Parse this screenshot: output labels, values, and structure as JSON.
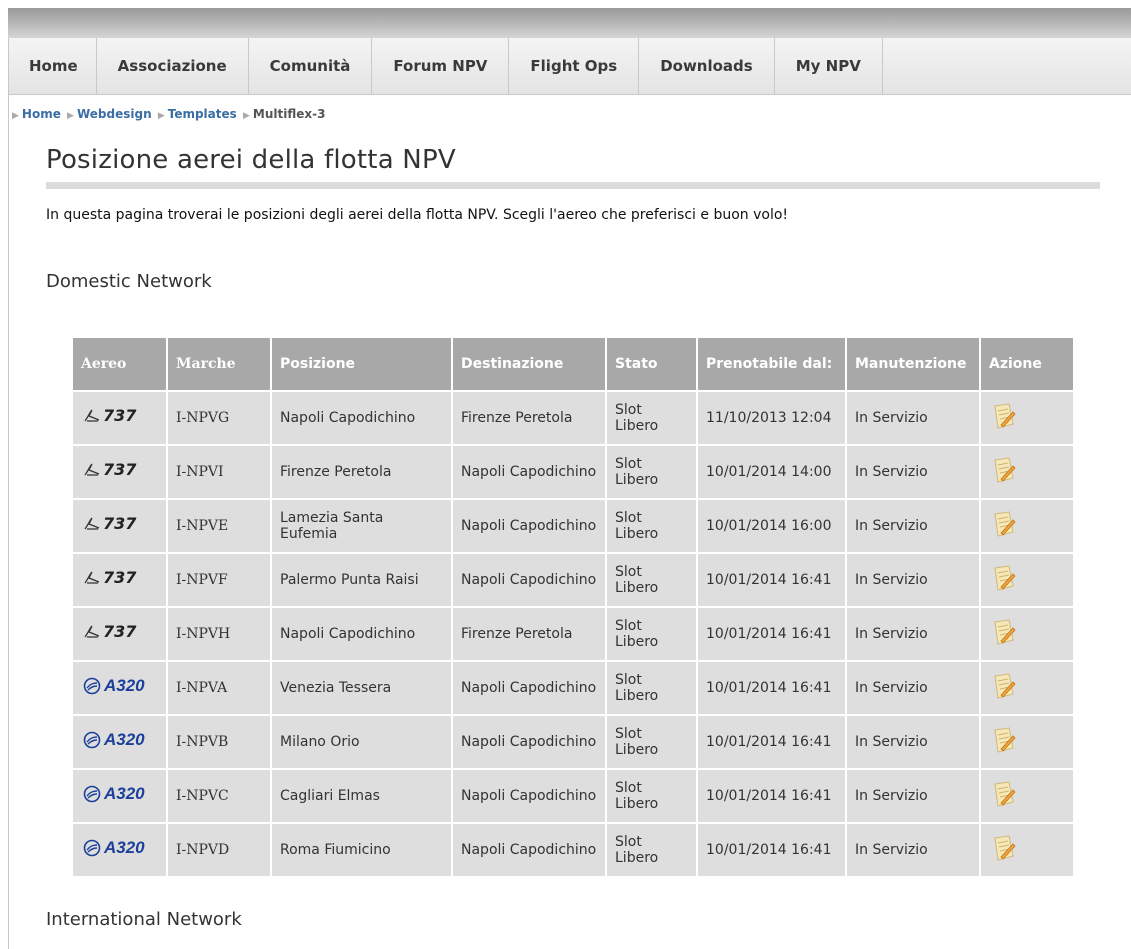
{
  "nav": {
    "items": [
      "Home",
      "Associazione",
      "Comunità",
      "Forum NPV",
      "Flight Ops",
      "Downloads",
      "My NPV"
    ]
  },
  "breadcrumb": {
    "items": [
      "Home",
      "Webdesign",
      "Templates",
      "Multiflex-3"
    ]
  },
  "page": {
    "title": "Posizione aerei della flotta NPV",
    "intro": "In questa pagina troverai le posizioni degli aerei della flotta NPV. Scegli l'aereo che preferisci e buon volo!"
  },
  "sections": {
    "domestic": "Domestic Network",
    "international": "International Network"
  },
  "table": {
    "headers": [
      "Aereo",
      "Marche",
      "Posizione",
      "Destinazione",
      "Stato",
      "Prenotabile dal:",
      "Manutenzione",
      "Azione"
    ],
    "rows": [
      {
        "aircraft": "737",
        "reg": "I-NPVG",
        "position": "Napoli Capodichino",
        "destination": "Firenze Peretola",
        "status": "Slot Libero",
        "available": "11/10/2013 12:04",
        "maintenance": "In Servizio",
        "action_icon": "notepad-icon"
      },
      {
        "aircraft": "737",
        "reg": "I-NPVI",
        "position": "Firenze Peretola",
        "destination": "Napoli Capodichino",
        "status": "Slot Libero",
        "available": "10/01/2014 14:00",
        "maintenance": "In Servizio",
        "action_icon": "notepad-icon"
      },
      {
        "aircraft": "737",
        "reg": "I-NPVE",
        "position": "Lamezia Santa Eufemia",
        "destination": "Napoli Capodichino",
        "status": "Slot Libero",
        "available": "10/01/2014 16:00",
        "maintenance": "In Servizio",
        "action_icon": "notepad-icon"
      },
      {
        "aircraft": "737",
        "reg": "I-NPVF",
        "position": "Palermo Punta Raisi",
        "destination": "Napoli Capodichino",
        "status": "Slot Libero",
        "available": "10/01/2014 16:41",
        "maintenance": "In Servizio",
        "action_icon": "notepad-icon"
      },
      {
        "aircraft": "737",
        "reg": "I-NPVH",
        "position": "Napoli Capodichino",
        "destination": "Firenze Peretola",
        "status": "Slot Libero",
        "available": "10/01/2014 16:41",
        "maintenance": "In Servizio",
        "action_icon": "notepad-icon"
      },
      {
        "aircraft": "A320",
        "reg": "I-NPVA",
        "position": "Venezia Tessera",
        "destination": "Napoli Capodichino",
        "status": "Slot Libero",
        "available": "10/01/2014 16:41",
        "maintenance": "In Servizio",
        "action_icon": "notepad-icon"
      },
      {
        "aircraft": "A320",
        "reg": "I-NPVB",
        "position": "Milano Orio",
        "destination": "Napoli Capodichino",
        "status": "Slot Libero",
        "available": "10/01/2014 16:41",
        "maintenance": "In Servizio",
        "action_icon": "notepad-icon"
      },
      {
        "aircraft": "A320",
        "reg": "I-NPVC",
        "position": "Cagliari Elmas",
        "destination": "Napoli Capodichino",
        "status": "Slot Libero",
        "available": "10/01/2014 16:41",
        "maintenance": "In Servizio",
        "action_icon": "notepad-icon"
      },
      {
        "aircraft": "A320",
        "reg": "I-NPVD",
        "position": "Roma Fiumicino",
        "destination": "Napoli Capodichino",
        "status": "Slot Libero",
        "available": "10/01/2014 16:41",
        "maintenance": "In Servizio",
        "action_icon": "notepad-icon"
      }
    ]
  },
  "colors": {
    "link": "#3a6ea5",
    "header_bg": "#a8a8a8",
    "cell_bg": "#dedede",
    "a320_blue": "#1b3f9a"
  }
}
